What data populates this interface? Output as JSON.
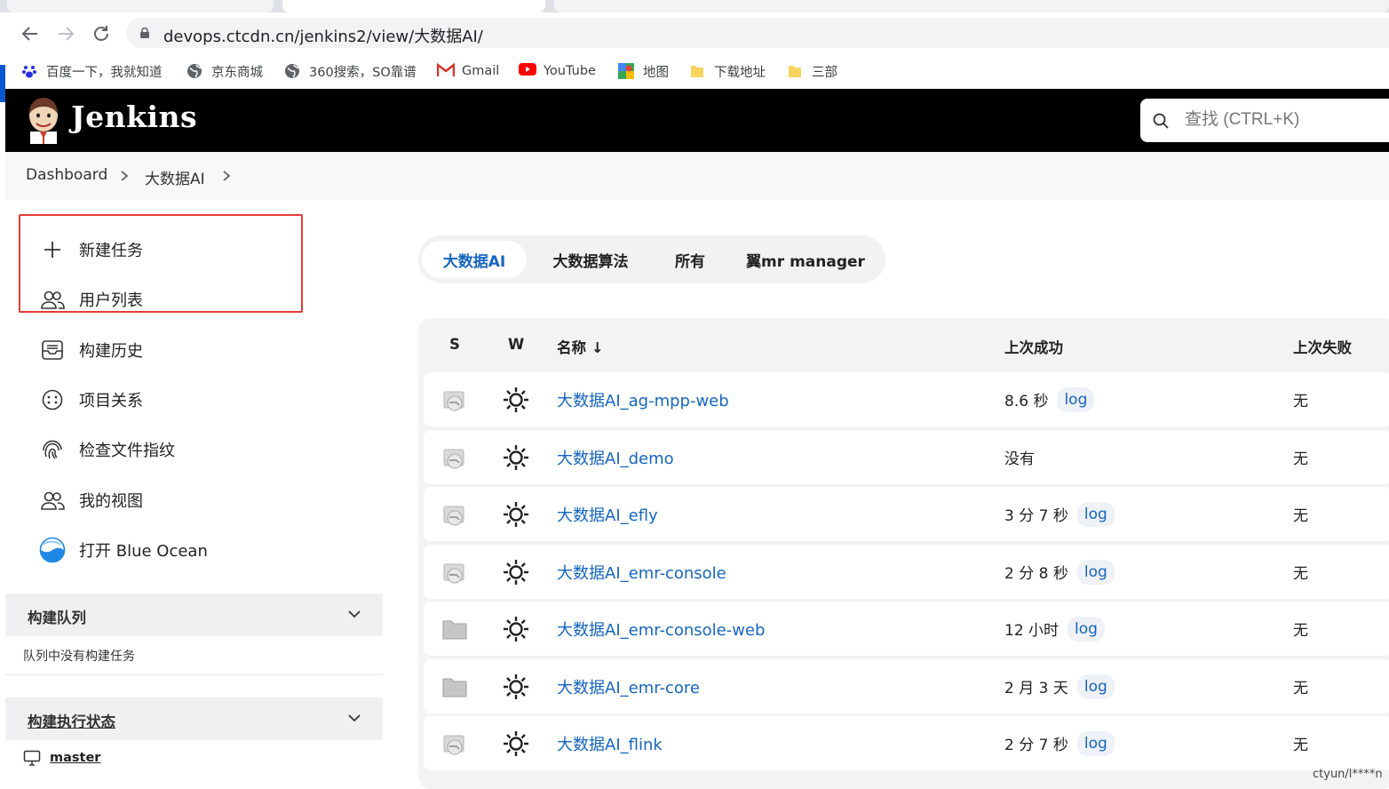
{
  "browser": {
    "url": "devops.ctcdn.cn/jenkins2/view/大数据AI/",
    "bookmarks": [
      {
        "label": "百度一下，我就知道",
        "icon": "baidu-icon"
      },
      {
        "label": "京东商城",
        "icon": "globe-icon"
      },
      {
        "label": "360搜索，SO靠谱",
        "icon": "globe-icon"
      },
      {
        "label": "Gmail",
        "icon": "gmail-icon"
      },
      {
        "label": "YouTube",
        "icon": "youtube-icon"
      },
      {
        "label": "地图",
        "icon": "maps-icon"
      },
      {
        "label": "下载地址",
        "icon": "folder-icon"
      },
      {
        "label": "三部",
        "icon": "folder-icon"
      }
    ]
  },
  "header": {
    "brand": "Jenkins",
    "search_placeholder": "查找 (CTRL+K)"
  },
  "breadcrumb": [
    "Dashboard",
    "大数据AI"
  ],
  "sidebar": {
    "items": [
      {
        "label": "新建任务",
        "icon": "plus-icon"
      },
      {
        "label": "用户列表",
        "icon": "people-icon"
      },
      {
        "label": "构建历史",
        "icon": "inbox-icon"
      },
      {
        "label": "项目关系",
        "icon": "smiley-circle-icon"
      },
      {
        "label": "检查文件指纹",
        "icon": "fingerprint-icon"
      },
      {
        "label": "我的视图",
        "icon": "people-icon"
      },
      {
        "label": "打开 Blue Ocean",
        "icon": "blue-ocean-icon"
      }
    ],
    "build_queue": {
      "title": "构建队列",
      "empty_text": "队列中没有构建任务"
    },
    "executor_status": {
      "title": "构建执行状态",
      "node": "master"
    }
  },
  "view_tabs": [
    "大数据AI",
    "大数据算法",
    "所有",
    "翼mr manager"
  ],
  "table": {
    "headers": {
      "s": "S",
      "w": "W",
      "name": "名称 ↓",
      "last_success": "上次成功",
      "last_failure": "上次失败"
    },
    "log_label": "log",
    "rows": [
      {
        "name": "大数据AI_ag-mpp-web",
        "last_success": "8.6 秒",
        "has_log": true,
        "last_failure": "无",
        "status": "disabled"
      },
      {
        "name": "大数据AI_demo",
        "last_success": "没有",
        "has_log": false,
        "last_failure": "无",
        "status": "disabled"
      },
      {
        "name": "大数据AI_efly",
        "last_success": "3 分 7 秒",
        "has_log": true,
        "last_failure": "无",
        "status": "disabled"
      },
      {
        "name": "大数据AI_emr-console",
        "last_success": "2 分 8 秒",
        "has_log": true,
        "last_failure": "无",
        "status": "disabled"
      },
      {
        "name": "大数据AI_emr-console-web",
        "last_success": "12 小时",
        "has_log": true,
        "last_failure": "无",
        "status": "folder"
      },
      {
        "name": "大数据AI_emr-core",
        "last_success": "2 月 3 天",
        "has_log": true,
        "last_failure": "无",
        "status": "folder"
      },
      {
        "name": "大数据AI_flink",
        "last_success": "2 分 7 秒",
        "has_log": true,
        "last_failure": "无",
        "status": "disabled"
      }
    ]
  },
  "watermark": "ctyun/l****n",
  "colors": {
    "accent": "#1565c0",
    "highlight_box": "#e53935",
    "header_bg": "#000000"
  }
}
